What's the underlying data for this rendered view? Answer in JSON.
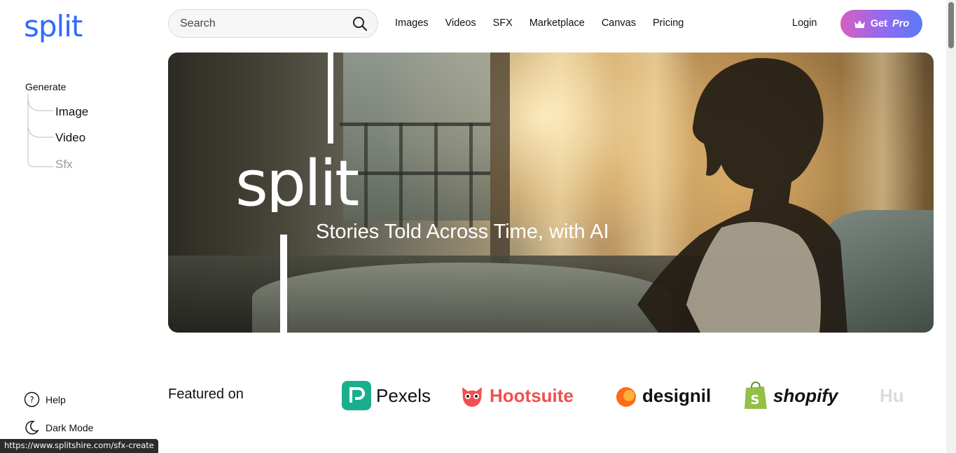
{
  "brand": {
    "logo_text": "split",
    "accent": "#2f6bff"
  },
  "sidebar": {
    "generate_title": "Generate",
    "items": [
      {
        "label": "Image",
        "active": true
      },
      {
        "label": "Video",
        "active": true
      },
      {
        "label": "Sfx",
        "active": false
      }
    ],
    "bottom": [
      {
        "label": "Help",
        "icon": "help-circle-icon"
      },
      {
        "label": "Dark Mode",
        "icon": "moon-icon"
      }
    ]
  },
  "header": {
    "search_placeholder": "Search",
    "nav": [
      "Images",
      "Videos",
      "SFX",
      "Marketplace",
      "Canvas",
      "Pricing"
    ],
    "login": "Login",
    "get_pro": {
      "prefix": "Get",
      "emph": "Pro",
      "icon": "crown-icon"
    }
  },
  "hero": {
    "brand_text": "split",
    "tagline": "Stories Told Across Time, with AI"
  },
  "featured": {
    "label": "Featured on",
    "partners": [
      "Pexels",
      "Hootsuite",
      "designil",
      "shopify",
      "Hu"
    ]
  },
  "status_url": "https://www.splitshire.com/sfx-create"
}
